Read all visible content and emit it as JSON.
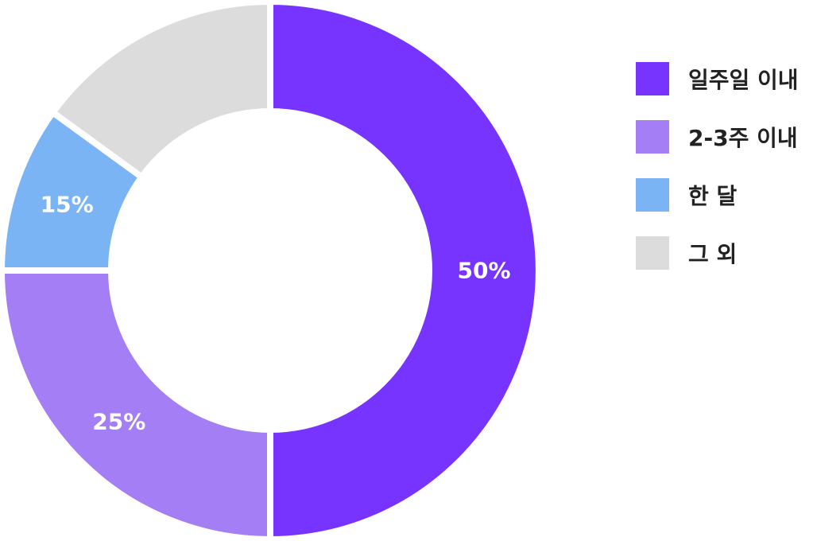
{
  "chart_data": {
    "type": "pie",
    "donut": true,
    "categories": [
      "일주일 이내",
      "2-3주 이내",
      "한 달",
      "그 외"
    ],
    "values": [
      50,
      25,
      10,
      15
    ],
    "slice_labels": [
      "50%",
      "25%",
      "15%",
      ""
    ],
    "colors": [
      "#7733ff",
      "#a37ef4",
      "#7ab4f4",
      "#dcdcdc"
    ],
    "legend_position": "right",
    "title": ""
  }
}
